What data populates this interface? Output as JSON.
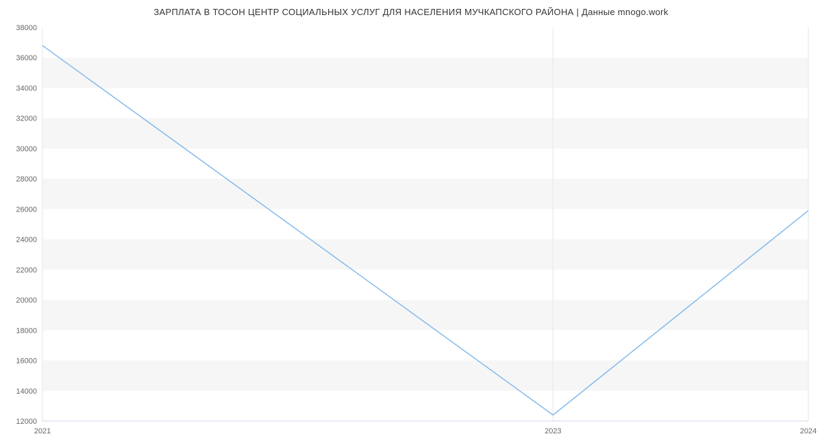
{
  "title": "ЗАРПЛАТА В ТОСОН ЦЕНТР СОЦИАЛЬНЫХ УСЛУГ ДЛЯ  НАСЕЛЕНИЯ  МУЧКАПСКОГО РАЙОНА | Данные mnogo.work",
  "chart_data": {
    "type": "line",
    "x": [
      2021,
      2023,
      2024
    ],
    "values": [
      36800,
      12400,
      25900
    ],
    "y_ticks": [
      12000,
      14000,
      16000,
      18000,
      20000,
      22000,
      24000,
      26000,
      28000,
      30000,
      32000,
      34000,
      36000,
      38000
    ],
    "x_ticks": [
      2021,
      2023,
      2024
    ],
    "title": "ЗАРПЛАТА В ТОСОН ЦЕНТР СОЦИАЛЬНЫХ УСЛУГ ДЛЯ  НАСЕЛЕНИЯ  МУЧКАПСКОГО РАЙОНА | Данные mnogo.work",
    "xlabel": "",
    "ylabel": "",
    "ylim": [
      12000,
      38000
    ],
    "xlim": [
      2021,
      2024
    ],
    "line_color": "#7cb5ec"
  }
}
